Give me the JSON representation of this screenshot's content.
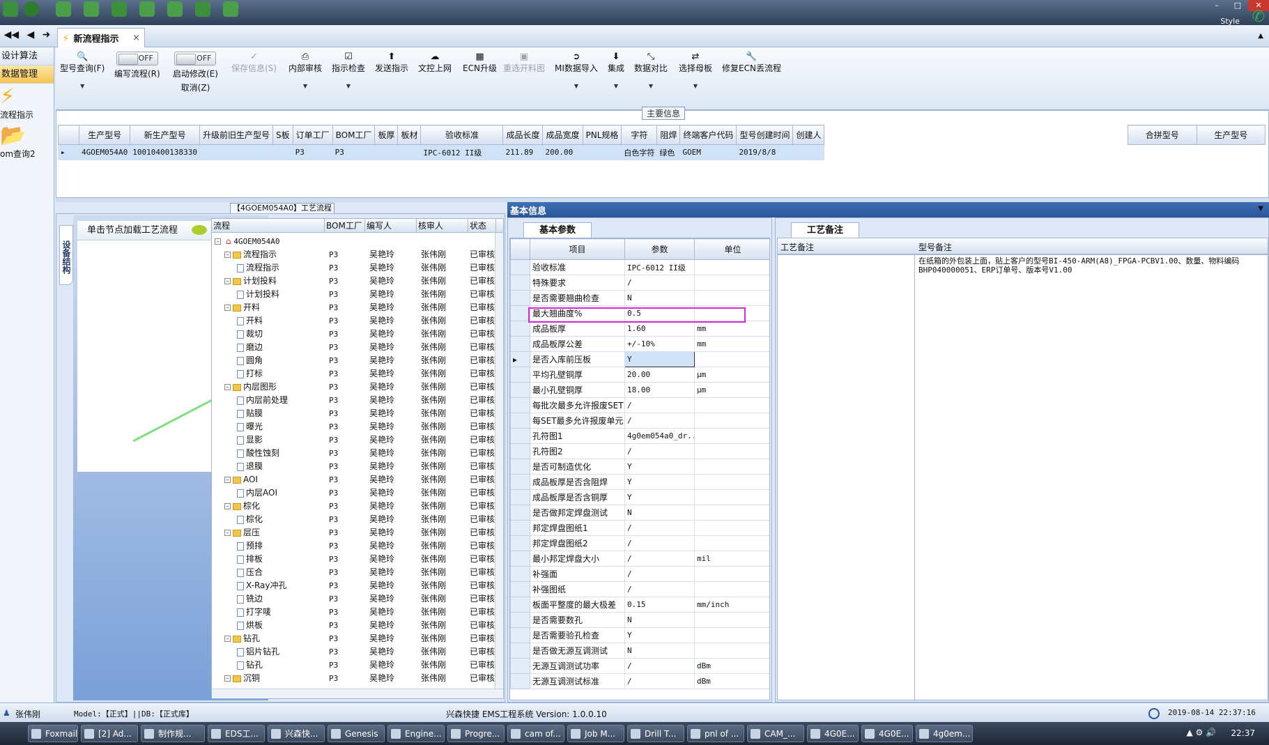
{
  "window": {
    "style_label": "Style"
  },
  "doc_tab": {
    "label": "新流程指示"
  },
  "leftnav": {
    "items": [
      "设计算法",
      "数据管理"
    ],
    "big_items": [
      "流程指示",
      "om查询2"
    ]
  },
  "toolbar": {
    "buttons": [
      {
        "label": "型号查询(F)"
      },
      {
        "label": "编写流程(R)"
      },
      {
        "label": "启动修改(E)",
        "label2": "取消(Z)"
      },
      {
        "label": "保存信息(S)"
      },
      {
        "label": "内部审核"
      },
      {
        "label": "指示检查"
      },
      {
        "label": "发送指示"
      },
      {
        "label": "文控上网"
      },
      {
        "label": "ECN升级"
      },
      {
        "label": "重选开料图"
      },
      {
        "label": "MI数据导入"
      },
      {
        "label": "集成"
      },
      {
        "label": "数据对比"
      },
      {
        "label": "选择母板"
      },
      {
        "label": "修复ECN丢流程"
      }
    ],
    "toggle_off": "OFF"
  },
  "main_info": {
    "caption": "主要信息",
    "headers": [
      "生产型号",
      "新生产型号",
      "升级前旧生产型号",
      "S板",
      "订单工厂",
      "BOM工厂",
      "板厚",
      "板材",
      "验收标准",
      "成品长度",
      "成品宽度",
      "PNL规格",
      "字符",
      "阻焊",
      "终端客户代码",
      "型号创建时间",
      "创建人"
    ],
    "row": [
      "4GOEM054A0",
      "10010400138330",
      "",
      "",
      "P3",
      "P3",
      "",
      "",
      "IPC-6012 II级",
      "211.89",
      "200.00",
      "",
      "白色字符",
      "绿色",
      "GOEM",
      "2019/8/8",
      ""
    ],
    "right_headers": [
      "合拼型号",
      "生产型号"
    ]
  },
  "flow": {
    "title": "【4GOEM054A0】工艺流程",
    "vertical_tab": "设备结构",
    "card_header": "单击节点加载工艺流程",
    "headers": [
      "流程",
      "BOM工厂",
      "编写人",
      "核审人",
      "状态"
    ],
    "root": "4GOEM054A0",
    "rows": [
      {
        "level": 1,
        "kind": "folder",
        "name": "流程指示",
        "bom": "P3",
        "writer": "吴艳玲",
        "checker": "张伟刚",
        "status": "已审核"
      },
      {
        "level": 2,
        "kind": "doc",
        "name": "流程指示",
        "bom": "P3",
        "writer": "吴艳玲",
        "checker": "张伟刚",
        "status": "已审核"
      },
      {
        "level": 1,
        "kind": "folder",
        "name": "计划投料",
        "bom": "P3",
        "writer": "吴艳玲",
        "checker": "张伟刚",
        "status": "已审核"
      },
      {
        "level": 2,
        "kind": "doc",
        "name": "计划投料",
        "bom": "P3",
        "writer": "吴艳玲",
        "checker": "张伟刚",
        "status": "已审核"
      },
      {
        "level": 1,
        "kind": "folder",
        "name": "开料",
        "bom": "P3",
        "writer": "吴艳玲",
        "checker": "张伟刚",
        "status": "已审核"
      },
      {
        "level": 2,
        "kind": "doc",
        "name": "开料",
        "bom": "P3",
        "writer": "吴艳玲",
        "checker": "张伟刚",
        "status": "已审核"
      },
      {
        "level": 2,
        "kind": "doc",
        "name": "裁切",
        "bom": "P3",
        "writer": "吴艳玲",
        "checker": "张伟刚",
        "status": "已审核"
      },
      {
        "level": 2,
        "kind": "doc",
        "name": "磨边",
        "bom": "P3",
        "writer": "吴艳玲",
        "checker": "张伟刚",
        "status": "已审核"
      },
      {
        "level": 2,
        "kind": "doc",
        "name": "圆角",
        "bom": "P3",
        "writer": "吴艳玲",
        "checker": "张伟刚",
        "status": "已审核"
      },
      {
        "level": 2,
        "kind": "doc",
        "name": "打标",
        "bom": "P3",
        "writer": "吴艳玲",
        "checker": "张伟刚",
        "status": "已审核"
      },
      {
        "level": 1,
        "kind": "folder",
        "name": "内层图形",
        "bom": "P3",
        "writer": "吴艳玲",
        "checker": "张伟刚",
        "status": "已审核"
      },
      {
        "level": 2,
        "kind": "doc",
        "name": "内层前处理",
        "bom": "P3",
        "writer": "吴艳玲",
        "checker": "张伟刚",
        "status": "已审核"
      },
      {
        "level": 2,
        "kind": "doc",
        "name": "贴膜",
        "bom": "P3",
        "writer": "吴艳玲",
        "checker": "张伟刚",
        "status": "已审核"
      },
      {
        "level": 2,
        "kind": "doc",
        "name": "曝光",
        "bom": "P3",
        "writer": "吴艳玲",
        "checker": "张伟刚",
        "status": "已审核"
      },
      {
        "level": 2,
        "kind": "doc",
        "name": "显影",
        "bom": "P3",
        "writer": "吴艳玲",
        "checker": "张伟刚",
        "status": "已审核"
      },
      {
        "level": 2,
        "kind": "doc",
        "name": "酸性蚀刻",
        "bom": "P3",
        "writer": "吴艳玲",
        "checker": "张伟刚",
        "status": "已审核"
      },
      {
        "level": 2,
        "kind": "doc",
        "name": "退膜",
        "bom": "P3",
        "writer": "吴艳玲",
        "checker": "张伟刚",
        "status": "已审核"
      },
      {
        "level": 1,
        "kind": "folder",
        "name": "AOI",
        "bom": "P3",
        "writer": "吴艳玲",
        "checker": "张伟刚",
        "status": "已审核"
      },
      {
        "level": 2,
        "kind": "doc",
        "name": "内层AOI",
        "bom": "P3",
        "writer": "吴艳玲",
        "checker": "张伟刚",
        "status": "已审核"
      },
      {
        "level": 1,
        "kind": "folder",
        "name": "棕化",
        "bom": "P3",
        "writer": "吴艳玲",
        "checker": "张伟刚",
        "status": "已审核"
      },
      {
        "level": 2,
        "kind": "doc",
        "name": "棕化",
        "bom": "P3",
        "writer": "吴艳玲",
        "checker": "张伟刚",
        "status": "已审核"
      },
      {
        "level": 1,
        "kind": "folder",
        "name": "层压",
        "bom": "P3",
        "writer": "吴艳玲",
        "checker": "张伟刚",
        "status": "已审核"
      },
      {
        "level": 2,
        "kind": "doc",
        "name": "预排",
        "bom": "P3",
        "writer": "吴艳玲",
        "checker": "张伟刚",
        "status": "已审核"
      },
      {
        "level": 2,
        "kind": "doc",
        "name": "排板",
        "bom": "P3",
        "writer": "吴艳玲",
        "checker": "张伟刚",
        "status": "已审核"
      },
      {
        "level": 2,
        "kind": "doc",
        "name": "压合",
        "bom": "P3",
        "writer": "吴艳玲",
        "checker": "张伟刚",
        "status": "已审核"
      },
      {
        "level": 2,
        "kind": "doc",
        "name": "X-Ray冲孔",
        "bom": "P3",
        "writer": "吴艳玲",
        "checker": "张伟刚",
        "status": "已审核"
      },
      {
        "level": 2,
        "kind": "doc",
        "name": "铣边",
        "bom": "P3",
        "writer": "吴艳玲",
        "checker": "张伟刚",
        "status": "已审核"
      },
      {
        "level": 2,
        "kind": "doc",
        "name": "打字唛",
        "bom": "P3",
        "writer": "吴艳玲",
        "checker": "张伟刚",
        "status": "已审核"
      },
      {
        "level": 2,
        "kind": "doc",
        "name": "烘板",
        "bom": "P3",
        "writer": "吴艳玲",
        "checker": "张伟刚",
        "status": "已审核"
      },
      {
        "level": 1,
        "kind": "folder",
        "name": "钻孔",
        "bom": "P3",
        "writer": "吴艳玲",
        "checker": "张伟刚",
        "status": "已审核"
      },
      {
        "level": 2,
        "kind": "doc",
        "name": "铝片钻孔",
        "bom": "P3",
        "writer": "吴艳玲",
        "checker": "张伟刚",
        "status": "已审核"
      },
      {
        "level": 2,
        "kind": "doc",
        "name": "钻孔",
        "bom": "P3",
        "writer": "吴艳玲",
        "checker": "张伟刚",
        "status": "已审核"
      },
      {
        "level": 1,
        "kind": "folder",
        "name": "沉铜",
        "bom": "P3",
        "writer": "吴艳玲",
        "checker": "张伟刚",
        "status": "已审核"
      }
    ]
  },
  "basic_info": {
    "header": "基本信息",
    "tab": "基本参数",
    "headers": [
      "项目",
      "参数",
      "单位"
    ],
    "rows": [
      {
        "item": "验收标准",
        "param": "IPC-6012 II级",
        "unit": ""
      },
      {
        "item": "特殊要求",
        "param": "/",
        "unit": ""
      },
      {
        "item": "是否需要翘曲检查",
        "param": "N",
        "unit": ""
      },
      {
        "item": "最大翘曲度%",
        "param": "0.5",
        "unit": ""
      },
      {
        "item": "成品板厚",
        "param": "1.60",
        "unit": "mm"
      },
      {
        "item": "成品板厚公差",
        "param": "+/-10%",
        "unit": "mm"
      },
      {
        "item": "是否入库前压板",
        "param": "Y",
        "unit": ""
      },
      {
        "item": "平均孔壁铜厚",
        "param": "20.00",
        "unit": "μm"
      },
      {
        "item": "最小孔壁铜厚",
        "param": "18.00",
        "unit": "μm"
      },
      {
        "item": "每批次最多允许报废SET",
        "param": "/",
        "unit": ""
      },
      {
        "item": "每SET最多允许报废单元",
        "param": "/",
        "unit": ""
      },
      {
        "item": "孔符图1",
        "param": "4g0em054a0_dr...",
        "unit": ""
      },
      {
        "item": "孔符图2",
        "param": "/",
        "unit": ""
      },
      {
        "item": "是否可制造优化",
        "param": "Y",
        "unit": ""
      },
      {
        "item": "成品板厚是否含阻焊",
        "param": "Y",
        "unit": ""
      },
      {
        "item": "成品板厚是否含铜厚",
        "param": "Y",
        "unit": ""
      },
      {
        "item": "是否做邦定焊盘测试",
        "param": "N",
        "unit": ""
      },
      {
        "item": "邦定焊盘图纸1",
        "param": "/",
        "unit": ""
      },
      {
        "item": "邦定焊盘图纸2",
        "param": "/",
        "unit": ""
      },
      {
        "item": "最小邦定焊盘大小",
        "param": "/",
        "unit": "mil"
      },
      {
        "item": "补强面",
        "param": "/",
        "unit": ""
      },
      {
        "item": "补强图纸",
        "param": "/",
        "unit": ""
      },
      {
        "item": "板面平整度的最大极差",
        "param": "0.15",
        "unit": "mm/inch"
      },
      {
        "item": "是否需要数孔",
        "param": "N",
        "unit": ""
      },
      {
        "item": "是否需要验孔检查",
        "param": "Y",
        "unit": ""
      },
      {
        "item": "是否做无源互调测试",
        "param": "N",
        "unit": ""
      },
      {
        "item": "无源互调测试功率",
        "param": "/",
        "unit": "dBm"
      },
      {
        "item": "无源互调测试标准",
        "param": "/",
        "unit": "dBm"
      }
    ]
  },
  "notes": {
    "tab": "工艺备注",
    "headers": [
      "工艺备注",
      "型号备注"
    ],
    "model_note": "在纸箱的外包装上面，贴上客户的型号BI-450-ARM(A8)_FPGA-PCBV1.00、数量、物料编码BHP040000051、ERP订单号、版本号V1.00"
  },
  "status": {
    "user": "张伟刚",
    "model": "Model:【正式】||DB:【正式库】",
    "system": "兴森快捷 EMS工程系统 Version: 1.0.0.10",
    "datetime": "2019-08-14 22:37:16"
  },
  "taskbar": {
    "items": [
      "Foxmail",
      "[2] Ad...",
      "制作规...",
      "EDS工...",
      "兴森快...",
      "Genesis",
      "Engine...",
      "Progre...",
      "cam of...",
      "Job M...",
      "Drill T...",
      "pnl of ...",
      "CAM_...",
      "4G0E...",
      "4G0E...",
      "4g0em..."
    ],
    "time": "22:37"
  }
}
